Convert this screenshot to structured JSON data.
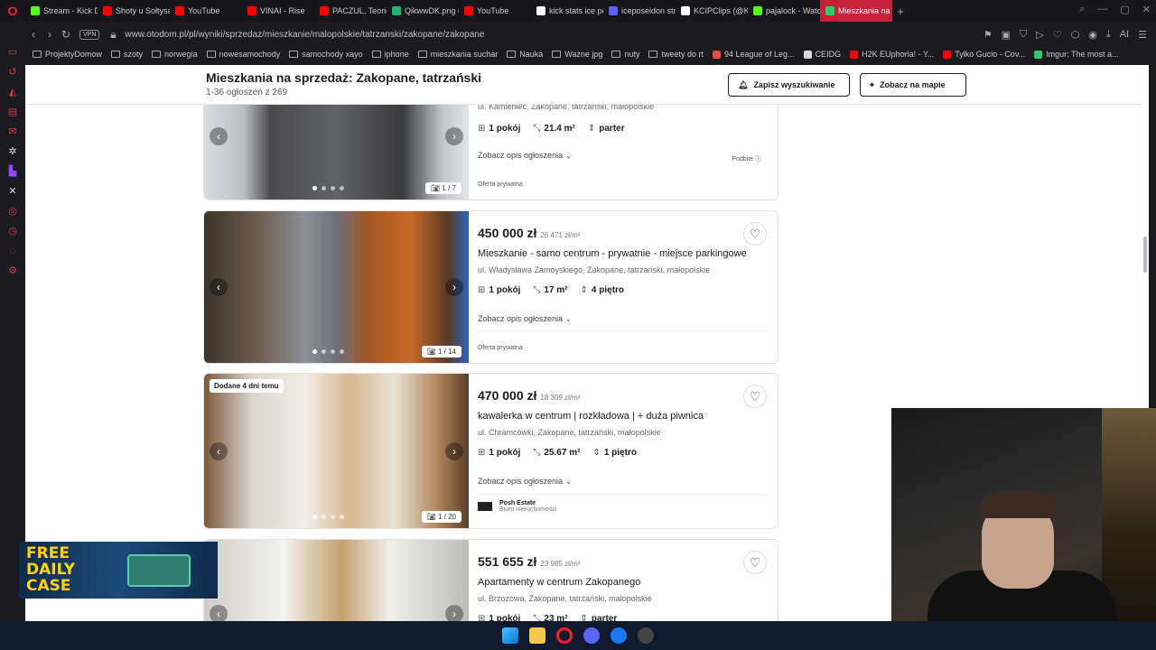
{
  "tabs": [
    {
      "label": "Stream - Kick De",
      "color": "#53fc18"
    },
    {
      "label": "Shoty u Sołtysa",
      "color": "#ff0000"
    },
    {
      "label": "YouTube",
      "color": "#ff0000"
    },
    {
      "label": "VINAI - Rise",
      "color": "#ff0000"
    },
    {
      "label": "PACZUL, Teorie",
      "color": "#ff0000"
    },
    {
      "label": "QikwwDK.png (",
      "color": "#1bb76e"
    },
    {
      "label": "YouTube",
      "color": "#ff0000"
    },
    {
      "label": "kick stats ice po",
      "color": "#ffffff"
    },
    {
      "label": "iceposeidon stre",
      "color": "#5865f2"
    },
    {
      "label": "KCIPClips (@KC",
      "color": "#ffffff"
    },
    {
      "label": "pajalock - Watc",
      "color": "#53fc18"
    },
    {
      "label": "Mieszkania na sprzedaż: Z",
      "color": "#2ecc71",
      "active": true
    }
  ],
  "new_tab": "+",
  "address": {
    "vpn": "VPN",
    "url": "www.otodom.pl/pl/wyniki/sprzedaz/mieszkanie/malopolskie/tatrzanski/zakopane/zakopane",
    "ai_label": "AI"
  },
  "bookmarks": [
    "ProjektyDomow",
    "szoty",
    "norwegia",
    "nowesamochody",
    "samochody xayo",
    "iphone",
    "mieszkania suchar",
    "Nauka",
    "Ważne jpg",
    "nuty",
    "tweety do rt",
    "94 League of Leg...",
    "CEIDG",
    "H2K EUphoria! - Y...",
    "Tylko Gucio - Cov...",
    "Imgur: The most a..."
  ],
  "header": {
    "title": "Mieszkania na sprzedaż: Zakopane, tatrzański",
    "count": "1-36 ogłoszeń z 269",
    "save_search": "Zapisz wyszukiwanie",
    "show_map": "Zobacz na mapie"
  },
  "listings": [
    {
      "address": "ul. Kamieniec, Zakopane, tatrzański, małopolskie",
      "rooms": "1 pokój",
      "area": "21.4 m²",
      "floor": "parter",
      "desc": "Zobacz opis ogłoszenia",
      "seller": "Oferta prywatna",
      "promo": "Podbite",
      "photo_counter": "1 / 7"
    },
    {
      "price": "450 000 zł",
      "ppm": "26 471 zł/m²",
      "title": "Mieszkanie - samo centrum - prywatnie - miejsce parkingowe",
      "address": "ul. Władysława Zamoyskiego, Zakopane, tatrzański, małopolskie",
      "rooms": "1 pokój",
      "area": "17 m²",
      "floor": "4 piętro",
      "desc": "Zobacz opis ogłoszenia",
      "seller": "Oferta prywatna",
      "photo_counter": "1 / 14"
    },
    {
      "badge": "Dodane 4 dni temu",
      "price": "470 000 zł",
      "ppm": "18 309 zł/m²",
      "title": "kawalerka w centrum | rozkładowa | + duża piwnica",
      "address": "ul. Chramcówki, Zakopane, tatrzański, małopolskie",
      "rooms": "1 pokój",
      "area": "25.67 m²",
      "floor": "1 piętro",
      "desc": "Zobacz opis ogłoszenia",
      "agency_name": "Posh Estate",
      "agency_type": "Biuro nieruchomości",
      "photo_counter": "1 / 20"
    },
    {
      "price": "551 655 zł",
      "ppm": "23 985 zł/m²",
      "title": "Apartamenty w centrum Zakopanego",
      "address": "ul. Brzozowa, Zakopane, tatrzański, małopolskie",
      "rooms": "1 pokój",
      "area": "23 m²",
      "floor": "parter"
    }
  ],
  "banner": {
    "line1": "FREE",
    "line2": "DAILY",
    "line3": "CASE"
  }
}
